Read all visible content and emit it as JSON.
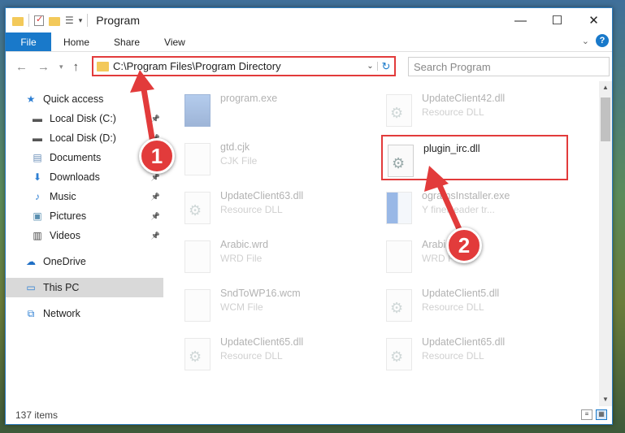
{
  "window": {
    "title": "Program"
  },
  "ribbon": {
    "file": "File",
    "tabs": [
      "Home",
      "Share",
      "View"
    ]
  },
  "address": {
    "path": "C:\\Program Files\\Program Directory",
    "search_placeholder": "Search Program"
  },
  "nav": [
    {
      "label": "Quick access",
      "icon": "star-icon",
      "pinned": false,
      "selected": false
    },
    {
      "label": "Local Disk (C:)",
      "icon": "drive-icon",
      "pinned": true,
      "selected": false
    },
    {
      "label": "Local Disk (D:)",
      "icon": "drive-icon",
      "pinned": true,
      "selected": false
    },
    {
      "label": "Documents",
      "icon": "documents-icon",
      "pinned": true,
      "selected": false
    },
    {
      "label": "Downloads",
      "icon": "download-icon",
      "pinned": true,
      "selected": false
    },
    {
      "label": "Music",
      "icon": "music-icon",
      "pinned": true,
      "selected": false
    },
    {
      "label": "Pictures",
      "icon": "pictures-icon",
      "pinned": true,
      "selected": false
    },
    {
      "label": "Videos",
      "icon": "videos-icon",
      "pinned": true,
      "selected": false
    },
    {
      "label": "OneDrive",
      "icon": "cloud-icon",
      "pinned": false,
      "selected": false
    },
    {
      "label": "This PC",
      "icon": "computer-icon",
      "pinned": false,
      "selected": true
    },
    {
      "label": "Network",
      "icon": "network-icon",
      "pinned": false,
      "selected": false
    }
  ],
  "files": [
    {
      "name": "program.exe",
      "type": "",
      "icon": "exe-icon",
      "faded": true
    },
    {
      "name": "UpdateClient42.dll",
      "type": "Resource DLL",
      "icon": "dll-icon",
      "faded": true
    },
    {
      "name": "gtd.cjk",
      "type": "CJK File",
      "icon": "file-icon",
      "faded": true
    },
    {
      "name": "plugin_irc.dll",
      "type": "",
      "icon": "dll-icon",
      "faded": false
    },
    {
      "name": "UpdateClient63.dll",
      "type": "Resource DLL",
      "icon": "dll-icon",
      "faded": true
    },
    {
      "name": "ogramsInstaller.exe",
      "type": "Y fineReader tr...",
      "icon": "installer-icon",
      "faded": true
    },
    {
      "name": "Arabic.wrd",
      "type": "WRD File",
      "icon": "file-icon",
      "faded": true
    },
    {
      "name": "Arabi",
      "type": "WRD F",
      "icon": "file-icon",
      "faded": true
    },
    {
      "name": "SndToWP16.wcm",
      "type": "WCM File",
      "icon": "file-icon",
      "faded": true
    },
    {
      "name": "UpdateClient5.dll",
      "type": "Resource DLL",
      "icon": "dll-icon",
      "faded": true
    },
    {
      "name": "UpdateClient65.dll",
      "type": "Resource DLL",
      "icon": "dll-icon",
      "faded": true
    },
    {
      "name": "UpdateClient65.dll",
      "type": "Resource DLL",
      "icon": "dll-icon",
      "faded": true
    }
  ],
  "status": {
    "count": "137 items"
  },
  "annotations": [
    {
      "number": "1",
      "color": "#e23b3b"
    },
    {
      "number": "2",
      "color": "#e23b3b"
    }
  ]
}
